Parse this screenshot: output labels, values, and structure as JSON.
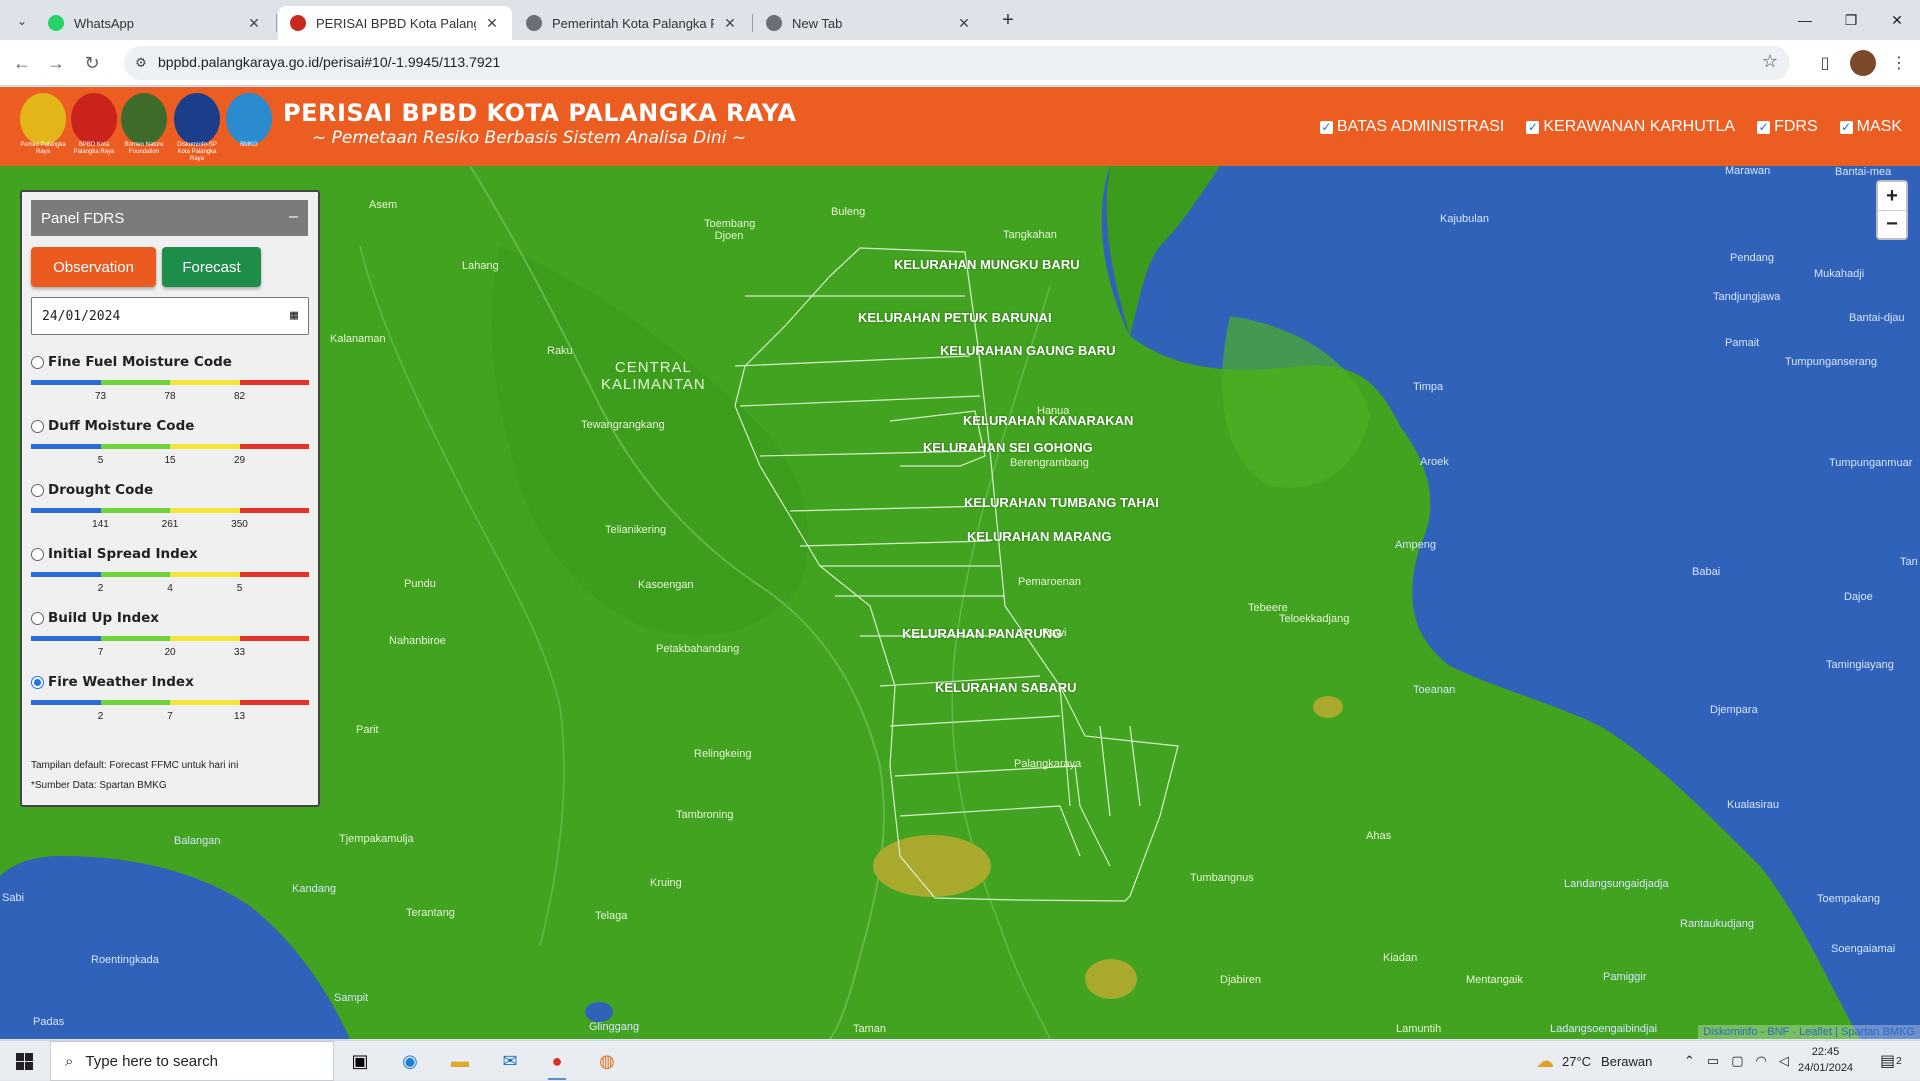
{
  "browser": {
    "tabs": [
      {
        "title": "WhatsApp",
        "favicon_color": "#25D366"
      },
      {
        "title": "PERISAI BPBD Kota Palangka Raya",
        "favicon_color": "#c7291e"
      },
      {
        "title": "Pemerintah Kota Palangka Raya",
        "favicon_color": "#6b6f75"
      },
      {
        "title": "New Tab",
        "favicon_color": "#6b6f75"
      }
    ],
    "url": "bppbd.palangkaraya.go.id/perisai#10/-1.9945/113.7921"
  },
  "site": {
    "title": "PERISAI BPBD KOTA PALANGKA RAYA",
    "subtitle": "~ Pemetaan Resiko Berbasis Sistem Analisa Dini ~",
    "logos": [
      {
        "caption": "Pemko Palangka Raya",
        "color": "#e2b619"
      },
      {
        "caption": "BPBD Kota Palangka Raya",
        "color": "#c9231c"
      },
      {
        "caption": "Borneo Nature Foundation",
        "color": "#3f6b2a"
      },
      {
        "caption": "Diskominfo-SP Kota Palangka Raya",
        "color": "#1b3d8a"
      },
      {
        "caption": "BMKG",
        "color": "#2a8ccf"
      }
    ],
    "layer_toggles": [
      "BATAS ADMINISTRASI",
      "KERAWANAN KARHUTLA",
      "FDRS",
      "MASK"
    ]
  },
  "panel": {
    "title": "Panel FDRS",
    "collapse": "–",
    "btn_observation": "Observation",
    "btn_forecast": "Forecast",
    "date": "24/01/2024",
    "bar_colors": [
      "#2a6bd6",
      "#6fd23c",
      "#f3e63a",
      "#e2322b"
    ],
    "indices": [
      {
        "name": "Fine Fuel Moisture Code",
        "ticks": [
          "73",
          "78",
          "82"
        ],
        "selected": false
      },
      {
        "name": "Duff Moisture Code",
        "ticks": [
          "5",
          "15",
          "29"
        ],
        "selected": false
      },
      {
        "name": "Drought Code",
        "ticks": [
          "141",
          "261",
          "350"
        ],
        "selected": false
      },
      {
        "name": "Initial Spread Index",
        "ticks": [
          "2",
          "4",
          "5"
        ],
        "selected": false
      },
      {
        "name": "Build Up Index",
        "ticks": [
          "7",
          "20",
          "33"
        ],
        "selected": false
      },
      {
        "name": "Fire Weather Index",
        "ticks": [
          "2",
          "7",
          "13"
        ],
        "selected": true
      }
    ],
    "note1": "Tampilan default: Forecast FFMC untuk hari ini",
    "note2": "*Sumber Data: Spartan BMKG"
  },
  "map": {
    "region_label": [
      "CENTRAL",
      "KALIMANTAN"
    ],
    "kelurahan": [
      "KELURAHAN MUNGKU BARU",
      "KELURAHAN PETUK BARUNAI",
      "KELURAHAN GAUNG BARU",
      "KELURAHAN KANARAKAN",
      "KELURAHAN SEI GOHONG",
      "KELURAHAN TUMBANG TAHAI",
      "KELURAHAN MARANG",
      "KELURAHAN PANARUNG",
      "KELURAHAN SABARU"
    ],
    "places": [
      "Asem",
      "Buleng",
      "Toembang Djoen",
      "Tangkahan",
      "Lahang",
      "Kalanaman",
      "Raku",
      "Tewangrangkang",
      "Hanua",
      "Berengrambang",
      "Telianikering",
      "Pundu",
      "Kasoengan",
      "Pemaroenan",
      "Nahanbiroe",
      "Petakbahandang",
      "Rawi",
      "Parit",
      "Relingkeing",
      "Palangkaraya",
      "Tambroning",
      "Balangan",
      "Tjempakamulja",
      "Kandang",
      "Kruing",
      "Terantang",
      "Telaga",
      "Sabi",
      "Roentingkada",
      "Sampit",
      "Padas",
      "Glinggang",
      "Taman",
      "Ahas",
      "Tumbangnus",
      "Kiadan",
      "Djabiren",
      "Mentangaik",
      "Lamuntih",
      "Tebeere",
      "Teloekkadjang",
      "Ampeng",
      "Aroek",
      "Toeanan",
      "Timpa",
      "Kajubulan",
      "Marawan",
      "Bantai-mea",
      "Pendang",
      "Mukahadji",
      "Tandjungjawa",
      "Bantai-djau",
      "Pamait",
      "Tumpunganserang",
      "Tumpunganmuar",
      "Babai",
      "Dajoe",
      "Tamingiayang",
      "Djempara",
      "Kualasirau",
      "Landangsungaidjadja",
      "Toempakang",
      "Rantaukudjang",
      "Soengaiamai",
      "Pamiggir",
      "Ladangsoengaibindjai",
      "Tan"
    ],
    "attribution": "Diskominfo - BNF - Leaflet | Spartan BMKG",
    "zoom_in": "+",
    "zoom_out": "−"
  },
  "taskbar": {
    "search_placeholder": "Type here to search",
    "weather_temp": "27°C",
    "weather_desc": "Berawan",
    "time": "22:45",
    "date": "24/01/2024",
    "notification_count": "2"
  }
}
